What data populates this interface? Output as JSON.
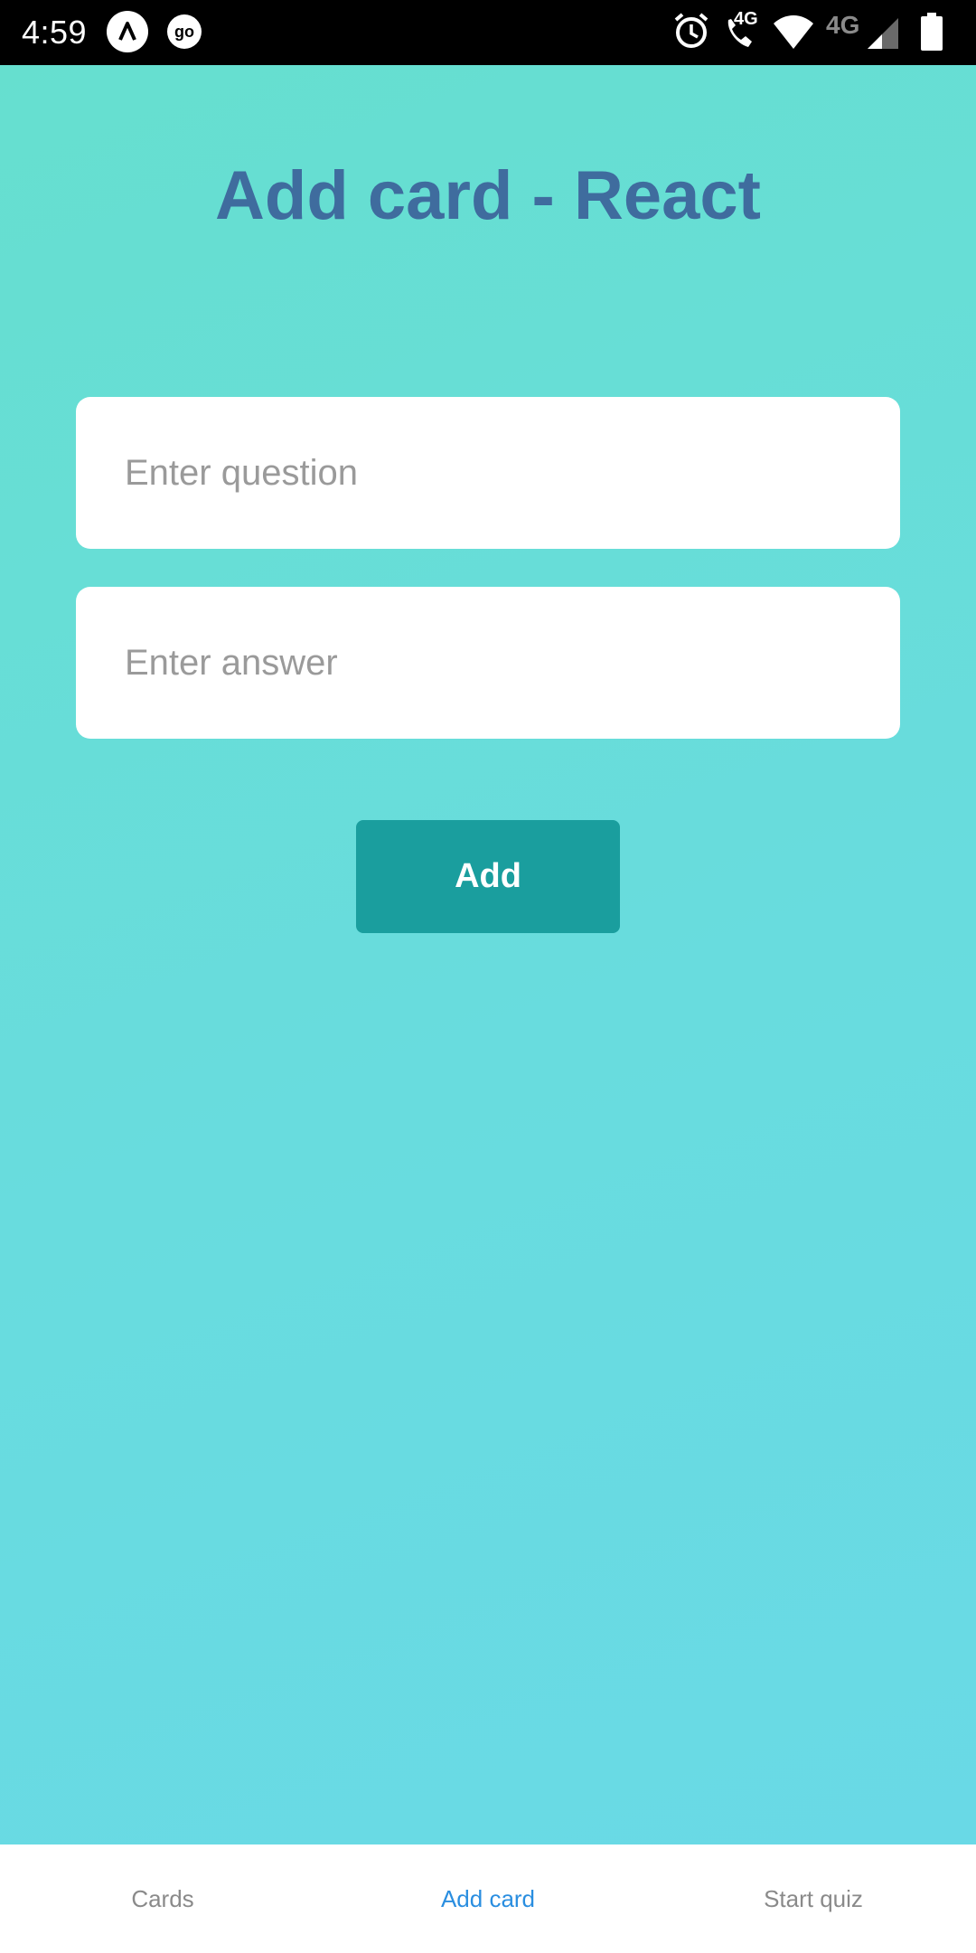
{
  "status_bar": {
    "time": "4:59",
    "call_badge": "4G",
    "network_label": "4G",
    "icons": [
      "launcher-app-icon",
      "go-app-icon",
      "alarm-icon",
      "volte-call-icon",
      "wifi-icon",
      "cell-signal-icon",
      "battery-icon"
    ]
  },
  "page": {
    "title": "Add card - React"
  },
  "form": {
    "question_placeholder": "Enter question",
    "question_value": "",
    "answer_placeholder": "Enter answer",
    "answer_value": "",
    "add_label": "Add"
  },
  "bottom_nav": {
    "items": [
      {
        "label": "Cards",
        "active": false
      },
      {
        "label": "Add card",
        "active": true
      },
      {
        "label": "Start quiz",
        "active": false
      }
    ]
  },
  "colors": {
    "title": "#3f6c9e",
    "button": "#1a9e9e",
    "active_tab": "#2a8ee0",
    "inactive_tab": "#8a8a8a",
    "background_top": "#66dfcf",
    "background_bottom": "#69d9e6"
  }
}
